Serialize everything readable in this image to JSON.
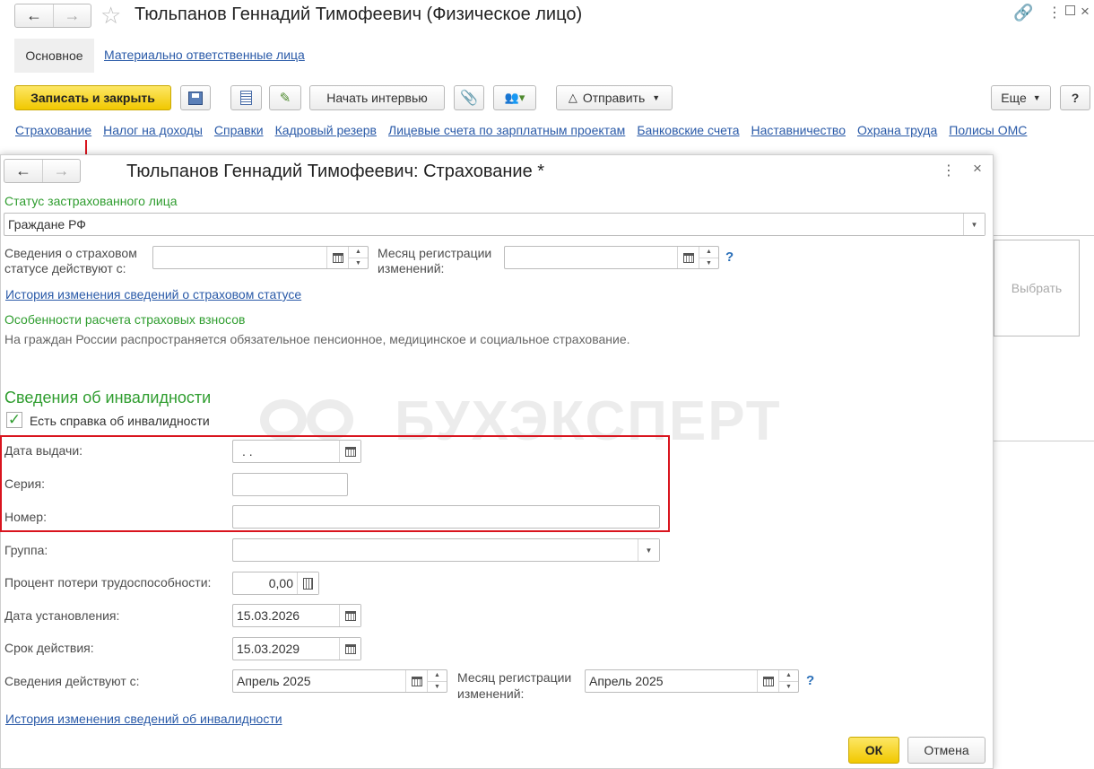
{
  "bg_window": {
    "title": "Тюльпанов Геннадий Тимофеевич (Физическое лицо)",
    "tabs": [
      "Основное",
      "Материально ответственные лица"
    ],
    "toolbar": {
      "save_close": "Записать и закрыть",
      "interview": "Начать интервью",
      "send": "Отправить",
      "more": "Еще",
      "help": "?"
    },
    "links": [
      "Страхование",
      "Налог на доходы",
      "Справки",
      "Кадровый резерв",
      "Лицевые счета по зарплатным проектам",
      "Банковские счета",
      "Наставничество",
      "Охрана труда",
      "Полисы ОМС"
    ],
    "photo_select": "Выбрать"
  },
  "dialog": {
    "title": "Тюльпанов Геннадий Тимофеевич: Страхование *",
    "status_label": "Статус застрахованного лица",
    "status_value": "Граждане РФ",
    "status_from_label_1": "Сведения о страховом",
    "status_from_label_2": "статусе действуют с:",
    "status_from_value": "",
    "reg_month_label_1": "Месяц регистрации",
    "reg_month_label_2": "изменений:",
    "reg_month_value": "",
    "help_q": "?",
    "status_history_link": "История изменения сведений о страховом статусе",
    "features_title": "Особенности расчета страховых взносов",
    "features_text": "На граждан России распространяется обязательное пенсионное, медицинское и социальное страхование.",
    "disability": {
      "title": "Сведения об инвалидности",
      "has_certificate_label": "Есть справка об инвалидности",
      "has_certificate": true,
      "issue_date_label": "Дата выдачи:",
      "issue_date_value": " .  .",
      "series_label": "Серия:",
      "series_value": "",
      "number_label": "Номер:",
      "number_value": "",
      "group_label": "Группа:",
      "group_value": "",
      "percent_label": "Процент потери трудоспособности:",
      "percent_value": "0,00",
      "set_date_label": "Дата установления:",
      "set_date_value": "15.03.2026",
      "validity_label": "Срок действия:",
      "validity_value": "15.03.2029",
      "effective_label": "Сведения действуют с:",
      "effective_value": "Апрель 2025",
      "reg_month_label_1": "Месяц регистрации",
      "reg_month_label_2": "изменений:",
      "reg_month_value": "Апрель 2025",
      "history_link": "История изменения сведений об инвалидности"
    },
    "ok": "ОК",
    "cancel": "Отмена"
  },
  "watermark": "БУХЭКСПЕРТ",
  "colors": {
    "accent_yellow": "#f7d31c",
    "highlight_red": "#d9141e",
    "green_text": "#2f9d2f",
    "link_blue": "#2a5aa8"
  }
}
